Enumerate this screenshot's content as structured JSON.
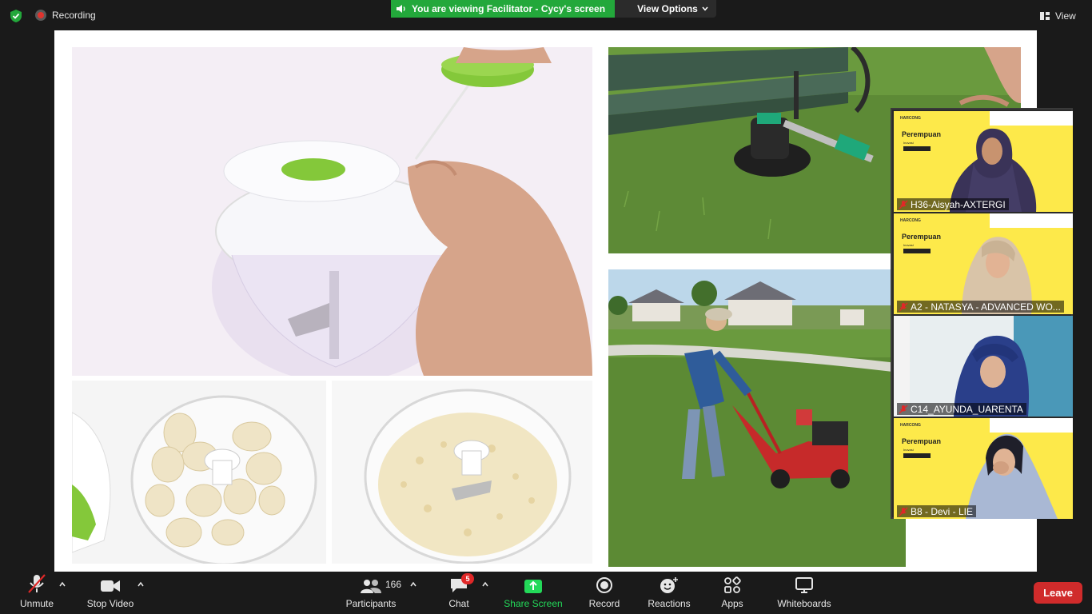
{
  "top": {
    "recording_label": "Recording",
    "banner_text": "You are viewing Facilitator - Cycy's screen",
    "view_options_label": "View Options",
    "view_label": "View"
  },
  "participants": [
    {
      "name": "H36-Aisyah-AXTERGI",
      "muted": true
    },
    {
      "name": "A2 - NATASYA - ADVANCED WO...",
      "muted": true
    },
    {
      "name": "C14_AYUNDA_UARENTA",
      "muted": true
    },
    {
      "name": "B8 - Devi - LIE",
      "muted": true
    }
  ],
  "tile_overlay": {
    "brand": "HARCONG",
    "title": "Perempuan",
    "title2": "Inovasi"
  },
  "toolbar": {
    "unmute_label": "Unmute",
    "stop_video_label": "Stop Video",
    "participants_label": "Participants",
    "participants_count": "166",
    "chat_label": "Chat",
    "chat_badge": "5",
    "share_screen_label": "Share Screen",
    "record_label": "Record",
    "reactions_label": "Reactions",
    "apps_label": "Apps",
    "whiteboards_label": "Whiteboards",
    "leave_label": "Leave"
  },
  "colors": {
    "banner_green": "#23a83b",
    "leave_red": "#d02b2b",
    "share_green": "#23d959",
    "tile_yellow": "#fde94a"
  }
}
